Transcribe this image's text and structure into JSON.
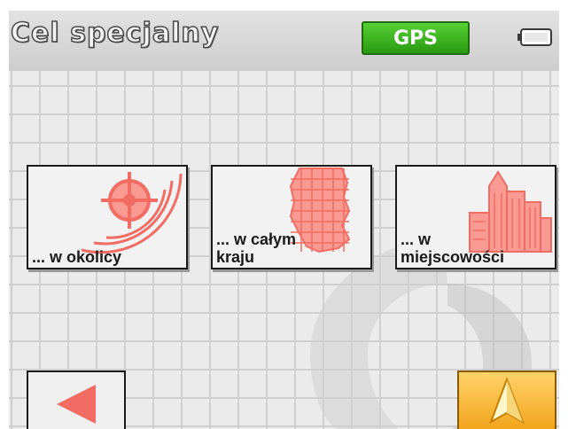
{
  "header": {
    "title": "Cel specjalny",
    "gps_label": "GPS",
    "battery_icon": "battery-icon"
  },
  "options": [
    {
      "label": "... w okolicy",
      "icon": "nearby-target-icon"
    },
    {
      "label": "... w całym\nkraju",
      "icon": "country-map-icon"
    },
    {
      "label": "... w\nmiejscowości",
      "icon": "city-buildings-icon"
    }
  ],
  "footer": {
    "back_icon": "back-arrow-icon",
    "navigate_icon": "navigation-arrow-icon"
  },
  "colors": {
    "gps_green": "#3cb71b",
    "icon_red": "#f26c63",
    "nav_orange": "#f7b93a"
  }
}
